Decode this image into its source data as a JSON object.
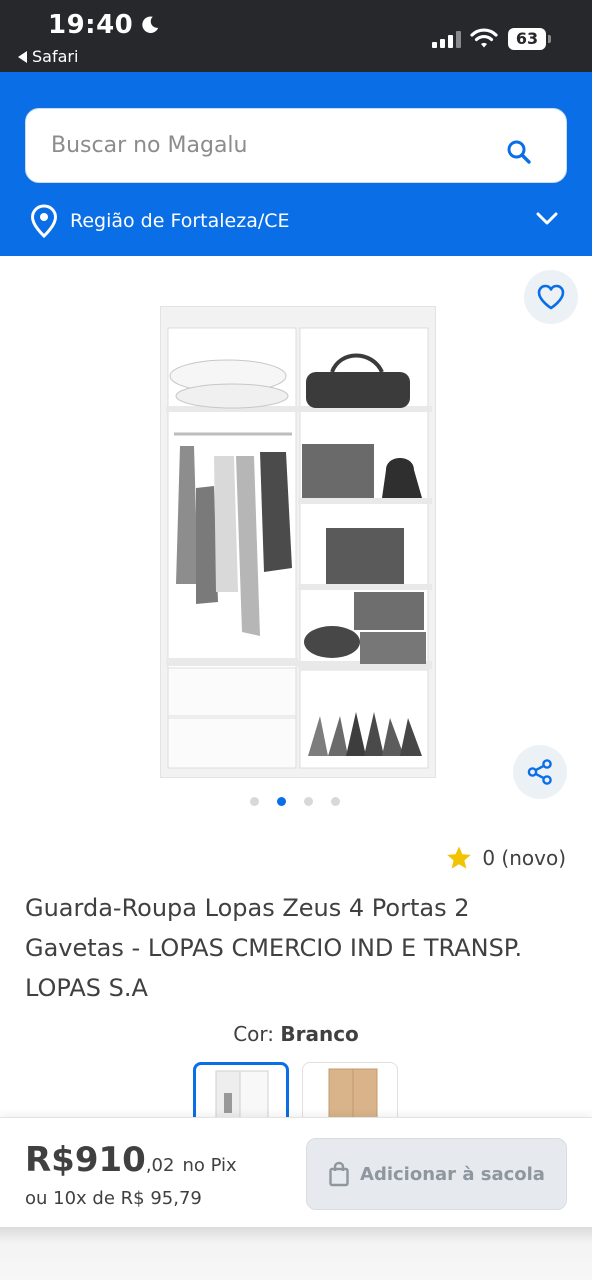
{
  "status_bar": {
    "time": "19:40",
    "back_app": "Safari",
    "battery": "63"
  },
  "header": {
    "search_placeholder": "Buscar no Magalu",
    "region": "Região de Fortaleza/CE",
    "accent_color": "#0a6ee6"
  },
  "product": {
    "carousel": {
      "count": 4,
      "active_index": 1
    },
    "rating_text": "0 (novo)",
    "title": "Guarda-Roupa Lopas Zeus 4 Portas 2 Gavetas - LOPAS CMERCIO IND E TRANSP. LOPAS S.A",
    "color_label": "Cor:",
    "color_value": "Branco",
    "swatches": [
      {
        "color": "#f4f4f4",
        "selected": true
      },
      {
        "color": "#d9b48a",
        "selected": false
      }
    ]
  },
  "purchase": {
    "price_main": "R$910",
    "price_cents": ",02",
    "price_suffix": "no Pix",
    "installments": "ou 10x de R$ 95,79",
    "add_button": "Adicionar à sacola"
  },
  "icons": {
    "favorite": "heart-icon",
    "share": "share-icon",
    "search": "search-icon",
    "location": "location-pin-icon",
    "chevron": "chevron-down-icon",
    "rating": "star-icon",
    "bag": "shopping-bag-icon"
  }
}
